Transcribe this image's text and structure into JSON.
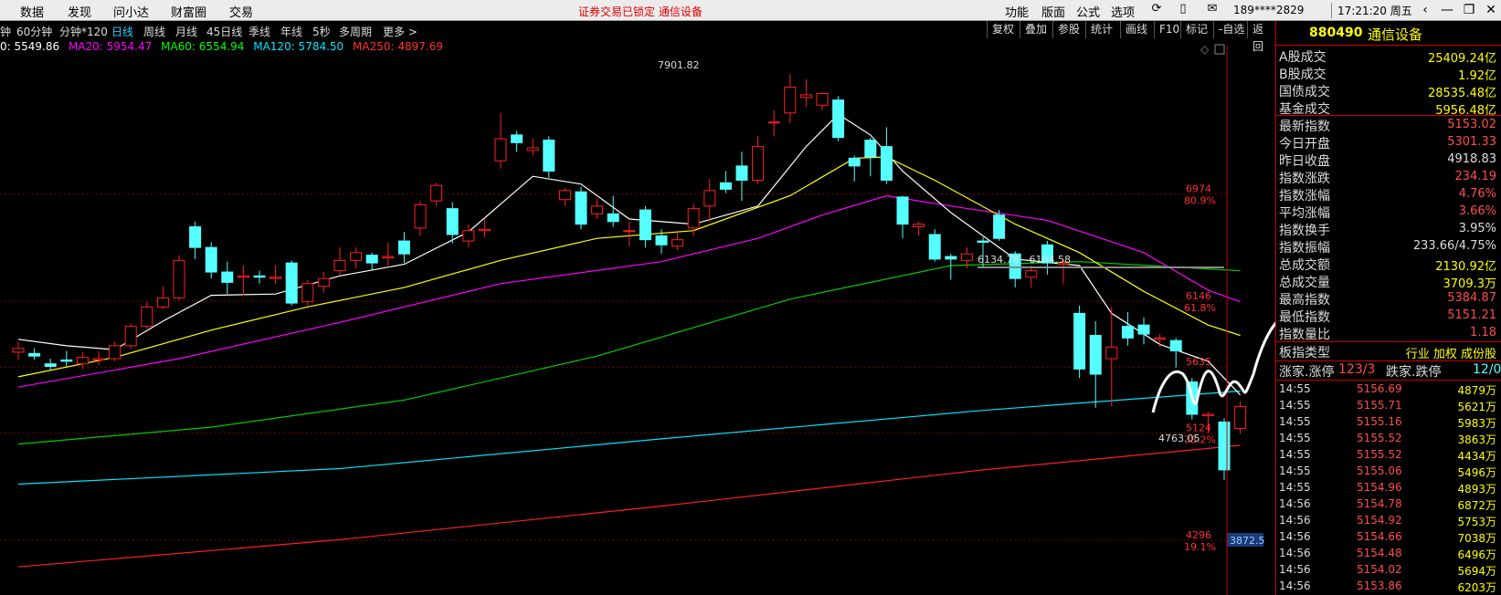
{
  "menu": [
    "数据",
    "发现",
    "问小达",
    "财富圈",
    "交易"
  ],
  "lock_notice": "证券交易已锁定  通信设备",
  "right_menu": [
    "功能",
    "版面",
    "公式",
    "选项"
  ],
  "user": "189****2829",
  "clock": "17:21:20 周五",
  "periods": [
    "钟",
    "60分钟",
    "分钟*120",
    "日线",
    "周线",
    "月线",
    "45日线",
    "季线",
    "年线",
    "5秒",
    "多周期",
    "更多 >"
  ],
  "active_period": "日线",
  "right_tools": [
    "复权",
    "叠加",
    "参股",
    "统计",
    "画线",
    "F10",
    "标记",
    "-自选",
    "返回"
  ],
  "ma": {
    "ma5": "0: 5549.86",
    "ma20": "MA20: 5954.47",
    "ma60": "MA60: 6554.94",
    "ma120": "MA120: 5784.50",
    "ma250": "MA250: 4897.69",
    "colors": {
      "ma5": "#ffffff",
      "ma20": "#ffff00",
      "ma60": "#ff00ff",
      "ma120": "#00ff00",
      "ma250": "#00e5ff"
    }
  },
  "chart_labels": {
    "high": "7901.82",
    "low": "4763.05",
    "range": "6134.78 - 6104.58",
    "marker": "3872.5"
  },
  "y_axis": [
    {
      "price": "6974",
      "pct": "80.9%"
    },
    {
      "price": "6146",
      "pct": "61.8%"
    },
    {
      "price": "5635",
      "pct": ""
    },
    {
      "price": "5124",
      "pct": "38.2%"
    },
    {
      "price": "4296",
      "pct": "19.1%"
    }
  ],
  "panel": {
    "code": "880490",
    "name": "通信设备",
    "stats": [
      {
        "label": "A股成交",
        "value": "25409.24亿",
        "color": "#ff0"
      },
      {
        "label": "B股成交",
        "value": "1.92亿",
        "color": "#ff0"
      },
      {
        "label": "国债成交",
        "value": "28535.48亿",
        "color": "#ff0"
      },
      {
        "label": "基金成交",
        "value": "5956.48亿",
        "color": "#ff0"
      },
      {
        "label": "最新指数",
        "value": "5153.02",
        "color": "#ff4d4d"
      },
      {
        "label": "今日开盘",
        "value": "5301.33",
        "color": "#ff4d4d"
      },
      {
        "label": "昨日收盘",
        "value": "4918.83",
        "color": "#ddd"
      },
      {
        "label": "指数涨跌",
        "value": "234.19",
        "color": "#ff4d4d"
      },
      {
        "label": "指数涨幅",
        "value": "4.76%",
        "color": "#ff4d4d"
      },
      {
        "label": "平均涨幅",
        "value": "3.66%",
        "color": "#ff4d4d"
      },
      {
        "label": "指数换手",
        "value": "3.95%",
        "color": "#ddd"
      },
      {
        "label": "指数振幅",
        "value": "233.66/4.75%",
        "color": "#ddd"
      },
      {
        "label": "总成交额",
        "value": "2130.92亿",
        "color": "#ff0"
      },
      {
        "label": "总成交量",
        "value": "3709.3万",
        "color": "#ff0"
      },
      {
        "label": "最高指数",
        "value": "5384.87",
        "color": "#ff4d4d"
      },
      {
        "label": "最低指数",
        "value": "5151.21",
        "color": "#ff4d4d"
      },
      {
        "label": "指数量比",
        "value": "1.18",
        "color": "#ff4d4d"
      }
    ],
    "type_label": "板指类型",
    "type_value": "行业 加权 成份股",
    "updown": {
      "up_label": "涨家.涨停",
      "up_value": "123/3",
      "down_label": "跌家.跌停",
      "down_value": "12/0"
    },
    "ticks": [
      {
        "time": "14:55",
        "price": "5156.69",
        "vol": "4879万"
      },
      {
        "time": "14:55",
        "price": "5155.71",
        "vol": "5621万"
      },
      {
        "time": "14:55",
        "price": "5155.16",
        "vol": "5983万"
      },
      {
        "time": "14:55",
        "price": "5155.52",
        "vol": "3863万"
      },
      {
        "time": "14:55",
        "price": "5155.52",
        "vol": "4434万"
      },
      {
        "time": "14:55",
        "price": "5155.06",
        "vol": "5496万"
      },
      {
        "time": "14:55",
        "price": "5154.96",
        "vol": "4893万"
      },
      {
        "time": "14:56",
        "price": "5154.78",
        "vol": "6872万"
      },
      {
        "time": "14:56",
        "price": "5154.92",
        "vol": "5753万"
      },
      {
        "time": "14:56",
        "price": "5154.66",
        "vol": "7038万"
      },
      {
        "time": "14:56",
        "price": "5154.48",
        "vol": "6496万"
      },
      {
        "time": "14:56",
        "price": "5154.02",
        "vol": "5694万"
      },
      {
        "time": "14:56",
        "price": "5153.86",
        "vol": "6203万"
      }
    ]
  },
  "chart_data": {
    "type": "candlestick",
    "y_range": [
      3872.5,
      8050
    ],
    "candles": [
      {
        "o": 5750,
        "c": 5780,
        "h": 5830,
        "l": 5690
      },
      {
        "o": 5740,
        "c": 5720,
        "h": 5780,
        "l": 5690
      },
      {
        "o": 5660,
        "c": 5640,
        "h": 5700,
        "l": 5610
      },
      {
        "o": 5690,
        "c": 5680,
        "h": 5760,
        "l": 5640
      },
      {
        "o": 5660,
        "c": 5710,
        "h": 5750,
        "l": 5620
      },
      {
        "o": 5690,
        "c": 5700,
        "h": 5760,
        "l": 5650
      },
      {
        "o": 5700,
        "c": 5800,
        "h": 5830,
        "l": 5680
      },
      {
        "o": 5800,
        "c": 5950,
        "h": 5970,
        "l": 5780
      },
      {
        "o": 5950,
        "c": 6100,
        "h": 6140,
        "l": 5930
      },
      {
        "o": 6100,
        "c": 6170,
        "h": 6260,
        "l": 6080
      },
      {
        "o": 6170,
        "c": 6460,
        "h": 6500,
        "l": 6150
      },
      {
        "o": 6720,
        "c": 6560,
        "h": 6760,
        "l": 6470
      },
      {
        "o": 6560,
        "c": 6370,
        "h": 6600,
        "l": 6320
      },
      {
        "o": 6370,
        "c": 6290,
        "h": 6450,
        "l": 6200
      },
      {
        "o": 6330,
        "c": 6340,
        "h": 6420,
        "l": 6190
      },
      {
        "o": 6340,
        "c": 6330,
        "h": 6380,
        "l": 6280
      },
      {
        "o": 6320,
        "c": 6330,
        "h": 6420,
        "l": 6280
      },
      {
        "o": 6440,
        "c": 6130,
        "h": 6460,
        "l": 6110
      },
      {
        "o": 6140,
        "c": 6280,
        "h": 6310,
        "l": 6110
      },
      {
        "o": 6260,
        "c": 6320,
        "h": 6370,
        "l": 6210
      },
      {
        "o": 6380,
        "c": 6460,
        "h": 6560,
        "l": 6350
      },
      {
        "o": 6460,
        "c": 6520,
        "h": 6560,
        "l": 6400
      },
      {
        "o": 6500,
        "c": 6440,
        "h": 6520,
        "l": 6380
      },
      {
        "o": 6480,
        "c": 6490,
        "h": 6600,
        "l": 6420
      },
      {
        "o": 6610,
        "c": 6510,
        "h": 6680,
        "l": 6440
      },
      {
        "o": 6710,
        "c": 6890,
        "h": 6920,
        "l": 6650
      },
      {
        "o": 6920,
        "c": 7040,
        "h": 7060,
        "l": 6880
      },
      {
        "o": 6860,
        "c": 6660,
        "h": 6910,
        "l": 6590
      },
      {
        "o": 6610,
        "c": 6690,
        "h": 6740,
        "l": 6560
      },
      {
        "o": 6690,
        "c": 6700,
        "h": 6780,
        "l": 6640
      },
      {
        "o": 7230,
        "c": 7400,
        "h": 7600,
        "l": 7170
      },
      {
        "o": 7430,
        "c": 7370,
        "h": 7460,
        "l": 7300
      },
      {
        "o": 7310,
        "c": 7330,
        "h": 7400,
        "l": 7270
      },
      {
        "o": 7390,
        "c": 7150,
        "h": 7420,
        "l": 7100
      },
      {
        "o": 6930,
        "c": 7000,
        "h": 7020,
        "l": 6880
      },
      {
        "o": 6990,
        "c": 6740,
        "h": 7030,
        "l": 6700
      },
      {
        "o": 6820,
        "c": 6880,
        "h": 6940,
        "l": 6780
      },
      {
        "o": 6820,
        "c": 6760,
        "h": 6960,
        "l": 6720
      },
      {
        "o": 6690,
        "c": 6690,
        "h": 6760,
        "l": 6570
      },
      {
        "o": 6850,
        "c": 6620,
        "h": 6880,
        "l": 6560
      },
      {
        "o": 6650,
        "c": 6580,
        "h": 6700,
        "l": 6510
      },
      {
        "o": 6570,
        "c": 6620,
        "h": 6680,
        "l": 6540
      },
      {
        "o": 6710,
        "c": 6860,
        "h": 6900,
        "l": 6650
      },
      {
        "o": 6880,
        "c": 7000,
        "h": 7090,
        "l": 6760
      },
      {
        "o": 7060,
        "c": 7010,
        "h": 7150,
        "l": 6980
      },
      {
        "o": 7190,
        "c": 7080,
        "h": 7300,
        "l": 6920
      },
      {
        "o": 7080,
        "c": 7340,
        "h": 7420,
        "l": 7050
      },
      {
        "o": 7530,
        "c": 7530,
        "h": 7620,
        "l": 7420
      },
      {
        "o": 7600,
        "c": 7800,
        "h": 7900,
        "l": 7520
      },
      {
        "o": 7720,
        "c": 7740,
        "h": 7860,
        "l": 7650
      },
      {
        "o": 7660,
        "c": 7750,
        "h": 7760,
        "l": 7620
      },
      {
        "o": 7700,
        "c": 7410,
        "h": 7730,
        "l": 7380
      },
      {
        "o": 7250,
        "c": 7190,
        "h": 7270,
        "l": 7070
      },
      {
        "o": 7390,
        "c": 7260,
        "h": 7410,
        "l": 7110
      },
      {
        "o": 7340,
        "c": 7080,
        "h": 7490,
        "l": 7050
      },
      {
        "o": 6950,
        "c": 6740,
        "h": 6960,
        "l": 6630
      },
      {
        "o": 6720,
        "c": 6740,
        "h": 6760,
        "l": 6650
      },
      {
        "o": 6660,
        "c": 6470,
        "h": 6700,
        "l": 6450
      },
      {
        "o": 6490,
        "c": 6470,
        "h": 6510,
        "l": 6310
      },
      {
        "o": 6460,
        "c": 6510,
        "h": 6560,
        "l": 6400
      },
      {
        "o": 6610,
        "c": 6600,
        "h": 6640,
        "l": 6400
      },
      {
        "o": 6810,
        "c": 6630,
        "h": 6850,
        "l": 6610
      },
      {
        "o": 6510,
        "c": 6320,
        "h": 6530,
        "l": 6250
      },
      {
        "o": 6330,
        "c": 6380,
        "h": 6420,
        "l": 6250
      },
      {
        "o": 6580,
        "c": 6440,
        "h": 6610,
        "l": 6350
      },
      {
        "o": 6430,
        "c": 6440,
        "h": 6470,
        "l": 6280
      },
      {
        "o": 6050,
        "c": 5620,
        "h": 6110,
        "l": 5550
      },
      {
        "o": 5880,
        "c": 5580,
        "h": 5990,
        "l": 5320
      },
      {
        "o": 5700,
        "c": 5790,
        "h": 6100,
        "l": 5330
      },
      {
        "o": 5950,
        "c": 5860,
        "h": 6060,
        "l": 5800
      },
      {
        "o": 5960,
        "c": 5890,
        "h": 6020,
        "l": 5810
      },
      {
        "o": 5850,
        "c": 5860,
        "h": 5890,
        "l": 5790
      },
      {
        "o": 5840,
        "c": 5760,
        "h": 5860,
        "l": 5630
      },
      {
        "o": 5520,
        "c": 5270,
        "h": 5550,
        "l": 5230
      },
      {
        "o": 5260,
        "c": 5270,
        "h": 5290,
        "l": 5120
      },
      {
        "o": 5210,
        "c": 4840,
        "h": 5240,
        "l": 4763
      },
      {
        "o": 5160,
        "c": 5330,
        "h": 5370,
        "l": 5120
      }
    ],
    "ma5": [
      [
        0,
        5850
      ],
      [
        3,
        5800
      ],
      [
        6,
        5770
      ],
      [
        9,
        5990
      ],
      [
        12,
        6190
      ],
      [
        16,
        6200
      ],
      [
        20,
        6340
      ],
      [
        24,
        6430
      ],
      [
        28,
        6680
      ],
      [
        32,
        7110
      ],
      [
        35,
        7050
      ],
      [
        38,
        6780
      ],
      [
        42,
        6740
      ],
      [
        46,
        6880
      ],
      [
        49,
        7340
      ],
      [
        51,
        7590
      ],
      [
        53,
        7430
      ],
      [
        55,
        7150
      ],
      [
        58,
        6830
      ],
      [
        62,
        6470
      ],
      [
        66,
        6420
      ],
      [
        68,
        6050
      ],
      [
        71,
        5810
      ],
      [
        74,
        5680
      ],
      [
        76,
        5420
      ]
    ],
    "ma20": [
      [
        0,
        5560
      ],
      [
        6,
        5710
      ],
      [
        12,
        5920
      ],
      [
        18,
        6100
      ],
      [
        24,
        6250
      ],
      [
        30,
        6460
      ],
      [
        36,
        6630
      ],
      [
        42,
        6690
      ],
      [
        48,
        6960
      ],
      [
        52,
        7250
      ],
      [
        54,
        7260
      ],
      [
        57,
        7080
      ],
      [
        62,
        6740
      ],
      [
        66,
        6520
      ],
      [
        70,
        6220
      ],
      [
        74,
        5960
      ],
      [
        76,
        5880
      ]
    ],
    "ma60": [
      [
        0,
        5480
      ],
      [
        10,
        5700
      ],
      [
        20,
        5980
      ],
      [
        30,
        6280
      ],
      [
        40,
        6450
      ],
      [
        46,
        6630
      ],
      [
        50,
        6810
      ],
      [
        54,
        6960
      ],
      [
        58,
        6880
      ],
      [
        64,
        6770
      ],
      [
        70,
        6520
      ],
      [
        74,
        6230
      ],
      [
        76,
        6140
      ]
    ],
    "ma120": [
      [
        0,
        5040
      ],
      [
        12,
        5170
      ],
      [
        24,
        5380
      ],
      [
        36,
        5720
      ],
      [
        48,
        6160
      ],
      [
        58,
        6420
      ],
      [
        66,
        6450
      ],
      [
        76,
        6380
      ]
    ],
    "ma250": [
      [
        0,
        4730
      ],
      [
        20,
        4850
      ],
      [
        40,
        5080
      ],
      [
        60,
        5300
      ],
      [
        76,
        5450
      ]
    ],
    "ma250_red": [
      [
        0,
        4090
      ],
      [
        20,
        4300
      ],
      [
        40,
        4560
      ],
      [
        60,
        4840
      ],
      [
        76,
        5030
      ]
    ]
  }
}
